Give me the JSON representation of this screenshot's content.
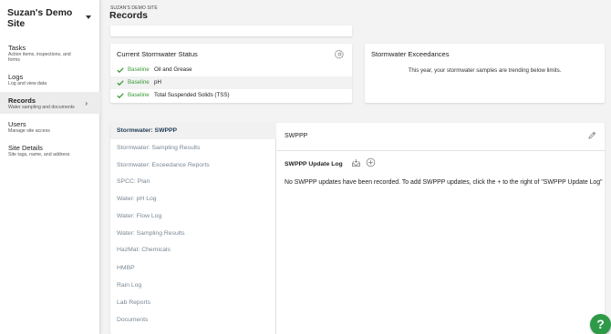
{
  "site": {
    "name": "Suzan's Demo Site"
  },
  "nav": {
    "items": [
      {
        "label": "Tasks",
        "sub": "Action items, inspections, and forms"
      },
      {
        "label": "Logs",
        "sub": "Log and view data"
      },
      {
        "label": "Records",
        "sub": "Water sampling and documents",
        "chevron": "›"
      },
      {
        "label": "Users",
        "sub": "Manage site access"
      },
      {
        "label": "Site Details",
        "sub": "Site tags, name, and address"
      }
    ]
  },
  "header": {
    "breadcrumb": "SUZAN'S DEMO SITE",
    "title": "Records"
  },
  "status": {
    "title": "Current Stormwater Status",
    "rows": [
      {
        "tag": "Baseline",
        "param": "Oil and Grease"
      },
      {
        "tag": "Baseline",
        "param": "pH"
      },
      {
        "tag": "Baseline",
        "param": "Total Suspended Solids (TSS)"
      }
    ]
  },
  "exceedances": {
    "title": "Stormwater Exceedances",
    "message": "This year, your stormwater samples are trending below limits."
  },
  "records": {
    "items": [
      "Stormwater: SWPPP",
      "Stormwater: Sampling Results",
      "Stormwater: Exceedance Reports",
      "SPCC: Plan",
      "Water: pH Log",
      "Water: Flow Log",
      "Water: Sampling Results",
      "HazMat: Chemicals",
      "HMBP",
      "Rain Log",
      "Lab Reports",
      "Documents"
    ]
  },
  "detail": {
    "title": "SWPPP",
    "log_title": "SWPPP Update Log",
    "empty_message": "No SWPPP updates have been recorded. To add SWPPP updates, click the + to the right of \"SWPPP Update Log\""
  },
  "help": {
    "label": "?"
  },
  "colors": {
    "accent_green": "#2e9a48",
    "baseline_green": "#3a9a3a",
    "active_text": "#1f3a55"
  },
  "icons": [
    "chevron-down-icon",
    "chevron-right-icon",
    "gear-icon",
    "check-icon",
    "pencil-icon",
    "tray-icon",
    "plus-circle-icon",
    "help-icon"
  ]
}
